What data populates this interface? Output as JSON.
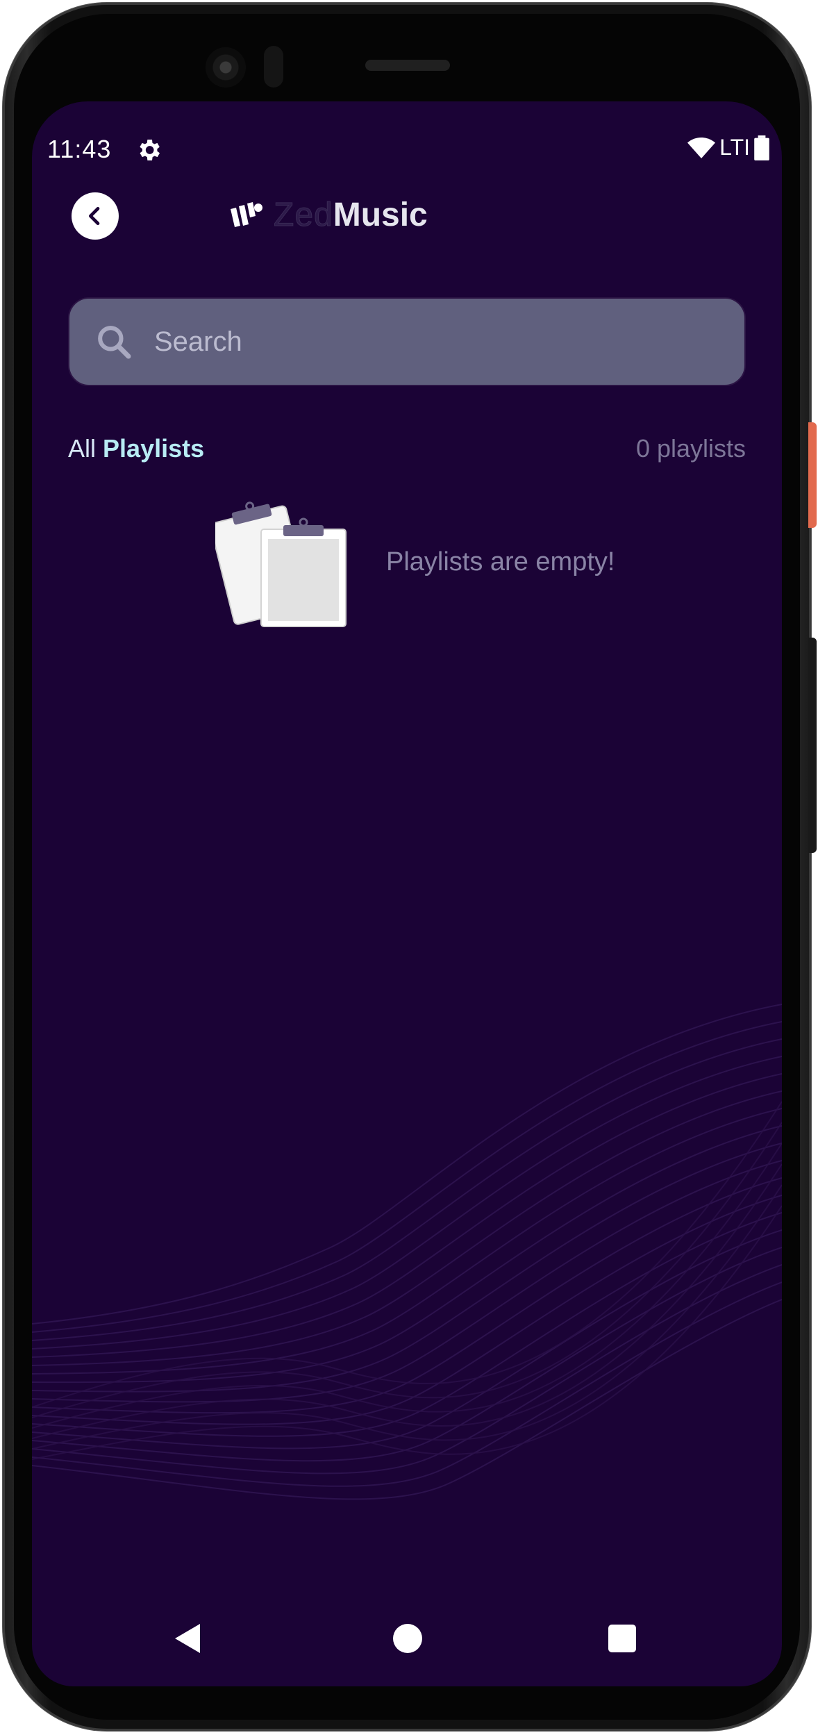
{
  "status_bar": {
    "time": "11:43",
    "network_label": "LTI",
    "icons": [
      "gear-icon",
      "wifi-icon",
      "battery-icon"
    ]
  },
  "header": {
    "back_icon": "chevron-left-icon",
    "logo_light": "Zed",
    "logo_bold": "Music"
  },
  "search": {
    "placeholder": "Search",
    "value": ""
  },
  "section": {
    "title_prefix": "All",
    "title_bold": "Playlists",
    "count": "0 playlists"
  },
  "empty_state": {
    "message": "Playlists are empty!",
    "icon": "clipboard-icon"
  },
  "nav": {
    "icons": [
      "back-icon",
      "home-icon",
      "recents-icon"
    ]
  },
  "colors": {
    "background": "#1b0336",
    "search_fill": "#60607e",
    "accent_text": "#b8ecf4",
    "muted_text": "#7d7698"
  }
}
